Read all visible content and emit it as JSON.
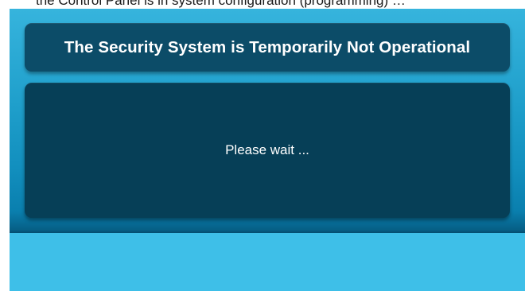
{
  "document": {
    "partial_line": "the Control Panel is in system configuration (programming) …"
  },
  "dialog": {
    "title": "The Security System is Temporarily Not Operational",
    "message": "Please wait ..."
  },
  "colors": {
    "background_top": "#36b4dd",
    "background_bottom": "#3ebfe8",
    "panel_title": "#0c4c68",
    "panel_content": "#063f57",
    "text": "#ffffff"
  }
}
